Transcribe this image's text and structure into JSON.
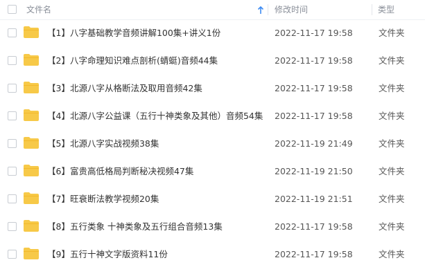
{
  "header": {
    "name_label": "文件名",
    "sort_icon": "arrow-up-icon",
    "modified_label": "修改时间",
    "type_label": "类型"
  },
  "colors": {
    "folder": "#f7c948",
    "folder_tab": "#f2b92c",
    "accent": "#3d8bf2"
  },
  "files": [
    {
      "name": "【1】八字基础教学音频讲解100集+讲义1份",
      "modified": "2022-11-17 19:58",
      "type": "文件夹"
    },
    {
      "name": "【2】八字命理知识难点剖析(蜻蜓)音频44集",
      "modified": "2022-11-17 19:58",
      "type": "文件夹"
    },
    {
      "name": "【3】北源八字从格断法及取用音频42集",
      "modified": "2022-11-17 19:58",
      "type": "文件夹"
    },
    {
      "name": "【4】北源八字公益课（五行十神类象及其他）音频54集",
      "modified": "2022-11-17 19:58",
      "type": "文件夹"
    },
    {
      "name": "【5】北源八字实战视频38集",
      "modified": "2022-11-19 21:49",
      "type": "文件夹"
    },
    {
      "name": "【6】富贵高低格局判断秘决视频47集",
      "modified": "2022-11-19 21:50",
      "type": "文件夹"
    },
    {
      "name": "【7】旺衰断法教学视频20集",
      "modified": "2022-11-19 21:51",
      "type": "文件夹"
    },
    {
      "name": "【8】五行类象 十神类象及五行组合音频13集",
      "modified": "2022-11-17 19:58",
      "type": "文件夹"
    },
    {
      "name": "【9】五行十神文字版资料11份",
      "modified": "2022-11-17 19:58",
      "type": "文件夹"
    }
  ]
}
